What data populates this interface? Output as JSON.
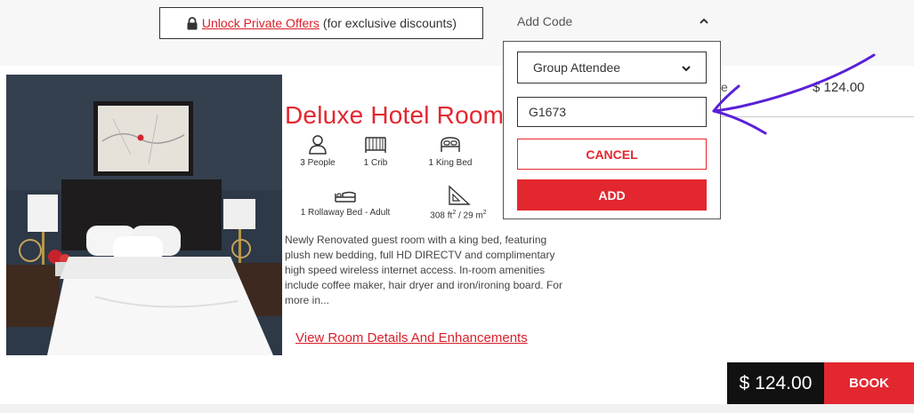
{
  "topbar": {
    "unlock_link": "Unlock Private Offers",
    "unlock_suffix": "(for exclusive discounts)",
    "add_code_label": "Add Code"
  },
  "code_panel": {
    "code_type_selected": "Group Attendee",
    "code_value": "G1673",
    "cancel_label": "CANCEL",
    "add_label": "ADD"
  },
  "room": {
    "title": "Deluxe Hotel Room",
    "amenities": [
      {
        "icon": "person-icon",
        "label": "3 People"
      },
      {
        "icon": "crib-icon",
        "label": "1 Crib"
      },
      {
        "icon": "bed-icon",
        "label": "1 King Bed"
      },
      {
        "icon": "rollaway-bed-icon",
        "label": "1 Rollaway Bed - Adult"
      },
      {
        "icon": "room-size-icon",
        "label_main": "308 ft",
        "label_sup1": "2",
        "label_mid": " / 29 m",
        "label_sup2": "2"
      }
    ],
    "description": "Newly Renovated guest room with a king bed, featuring plush new bedding, full HD DIRECTV and complimentary high speed wireless internet access. In-room amenities include coffee maker, hair dryer and iron/ironing board. For more in...",
    "view_details_link": "View Room Details And Enhancements"
  },
  "rate": {
    "label_fragment": "e",
    "price": "$ 124.00"
  },
  "footer": {
    "total_price": "$ 124.00",
    "book_label": "BOOK"
  },
  "colors": {
    "accent": "#e3272f",
    "annotation": "#5a1fd8",
    "price_box": "#111111"
  }
}
